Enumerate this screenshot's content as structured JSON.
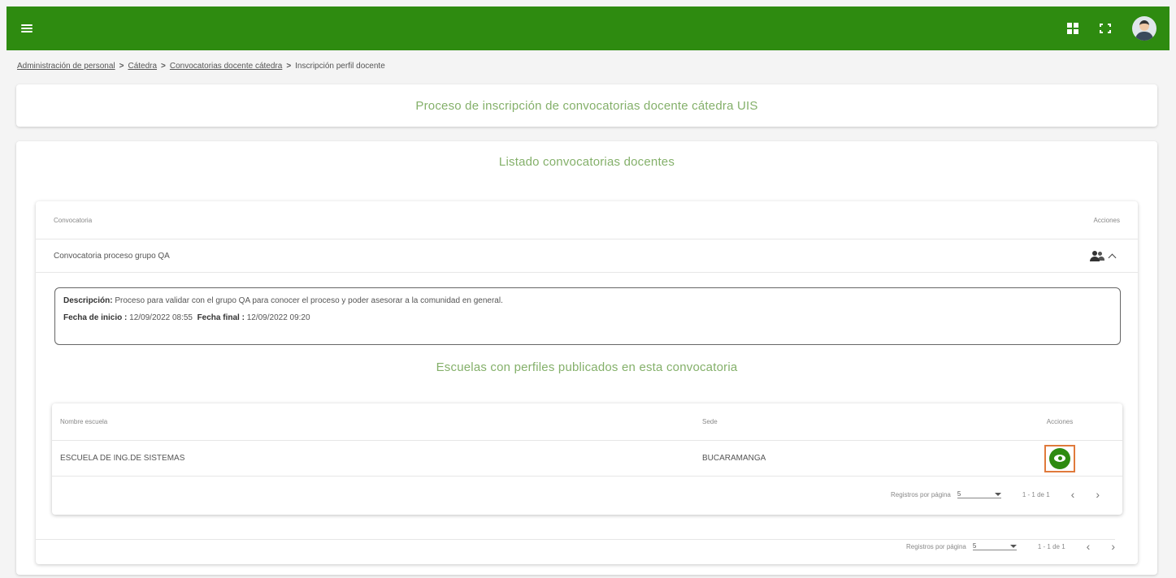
{
  "header": {
    "menu_icon": "hamburger-icon",
    "apps_icon": "grid-apps-icon",
    "fullscreen_icon": "fullscreen-icon",
    "avatar_icon": "user-avatar",
    "bar_color": "#2e8b10"
  },
  "breadcrumb": {
    "items": [
      "Administración de personal",
      "Cátedra",
      "Convocatorias docente cátedra"
    ],
    "current": "Inscripción perfil docente",
    "separator": ">"
  },
  "page_title": "Proceso de inscripción de convocatorias docente cátedra UIS",
  "list_title": "Listado convocatorias docentes",
  "table": {
    "col_convocatoria": "Convocatoria",
    "col_acciones": "Acciones",
    "row_name": "Convocatoria proceso grupo QA",
    "people_icon": "people-icon",
    "collapse_icon": "chevron-up-icon"
  },
  "details": {
    "descripcion_label": "Descripción:",
    "descripcion": "Proceso para validar con el grupo QA para conocer el proceso y poder asesorar a la comunidad en general.",
    "fecha_inicio_label": "Fecha de inicio :",
    "fecha_inicio": "12/09/2022 08:55",
    "fecha_final_label": "Fecha final :",
    "fecha_final": "12/09/2022 09:20"
  },
  "schools": {
    "title": "Escuelas con perfiles publicados en esta convocatoria",
    "col_nombre": "Nombre escuela",
    "col_sede": "Sede",
    "col_acciones": "Acciones",
    "row_nombre": "ESCUELA DE ING.DE SISTEMAS",
    "row_sede": "BUCARAMANGA",
    "view_icon": "eye-icon",
    "highlight_color": "#e07a3c"
  },
  "paginator_inner": {
    "label": "Registros por página",
    "page_size": "5",
    "range": "1 - 1 de 1",
    "prev": "‹",
    "next": "›"
  },
  "paginator_outer": {
    "label": "Registros por página",
    "page_size": "5",
    "range": "1 - 1 de 1",
    "prev": "‹",
    "next": "›"
  }
}
